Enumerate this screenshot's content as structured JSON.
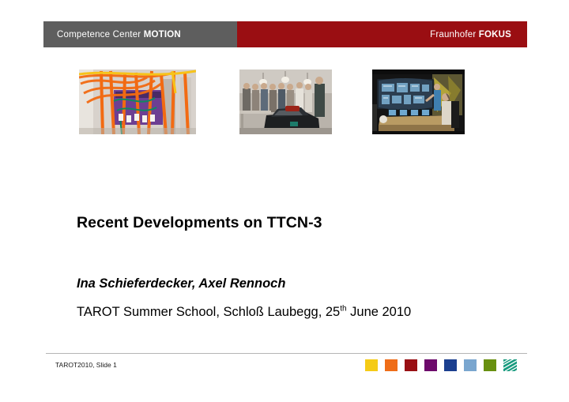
{
  "header": {
    "left_prefix": "Competence Center ",
    "left_bold": "MOTION",
    "right_prefix": "Fraunhofer ",
    "right_bold": "FOKUS",
    "left_bg": "#5e5e5e",
    "right_bg": "#9a0e12"
  },
  "photos": [
    {
      "name": "fiber-optic-cabling-photo",
      "alt": "Orange fiber-optic cables in a telecom rack"
    },
    {
      "name": "vehicle-demonstration-photo",
      "alt": "Group of people around a car in a lab"
    },
    {
      "name": "control-room-photo",
      "alt": "Operators at a control room with a large curved screen"
    }
  ],
  "slide": {
    "title": "Recent Developments on TTCN-3",
    "authors": "Ina Schieferdecker, Axel Rennoch",
    "venue_before": "TAROT Summer School, Schloß Laubegg, 25",
    "venue_superscript": "th",
    "venue_after": " June 2010"
  },
  "footer": {
    "note": "TAROT2010, Slide 1",
    "swatches": [
      {
        "name": "swatch-yellow",
        "color": "#f5cb16"
      },
      {
        "name": "swatch-orange",
        "color": "#ef6d18"
      },
      {
        "name": "swatch-dark-red",
        "color": "#990f13"
      },
      {
        "name": "swatch-purple",
        "color": "#6d0a6b"
      },
      {
        "name": "swatch-dark-blue",
        "color": "#1b3f8f"
      },
      {
        "name": "swatch-light-blue",
        "color": "#7aa6cf"
      },
      {
        "name": "swatch-olive-green",
        "color": "#68900f"
      }
    ],
    "logo_color": "#179a7e"
  }
}
